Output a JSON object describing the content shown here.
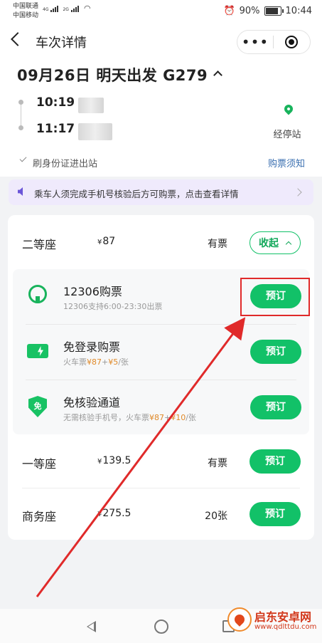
{
  "status_bar": {
    "carrier1": "中国联通",
    "carrier2": "中国移动",
    "net1": "4G",
    "net2": "2G",
    "battery": "90%",
    "time": "10:44"
  },
  "nav": {
    "title": "车次详情",
    "menu_glyph": "•••"
  },
  "trip": {
    "date_line": "09月26日 明天出发 G279",
    "depart_time": "10:19",
    "arrive_time": "11:17",
    "via_label": "经停站",
    "id_note": "刷身份证进出站",
    "notice_link": "购票须知"
  },
  "banner": {
    "text": "乘车人须完成手机号核验后方可购票，点击查看详情"
  },
  "seats": {
    "second": {
      "name": "二等座",
      "currency": "¥",
      "price": "87",
      "avail": "有票",
      "collapse_label": "收起"
    },
    "first": {
      "name": "一等座",
      "currency": "¥",
      "price": "139.5",
      "avail": "有票",
      "button": "预订"
    },
    "business": {
      "name": "商务座",
      "currency": "¥",
      "price": "275.5",
      "avail": "20张",
      "button": "预订"
    }
  },
  "options": [
    {
      "title": "12306购票",
      "sub": "12306支持6:00-23:30出票",
      "button": "预订"
    },
    {
      "title": "免登录购票",
      "sub_prefix": "火车票",
      "sub_price1": "¥87",
      "sub_plus": "+",
      "sub_price2": "¥5",
      "sub_suffix": "/张",
      "button": "预订"
    },
    {
      "title": "免核验通道",
      "sub_prefix": "无需核验手机号，火车票",
      "sub_price1": "¥87",
      "sub_plus": "+",
      "sub_price2": "¥10",
      "sub_suffix": "/张",
      "button": "预订",
      "icon_text": "免"
    }
  ],
  "watermark": {
    "name": "启东安卓网",
    "url": "www.qdlttdu.com"
  },
  "colors": {
    "accent_green": "#12c168",
    "highlight_red": "#e02a2a",
    "link_blue": "#3a6fb0",
    "banner_bg": "#efeafc",
    "price_orange": "#e08a2a"
  }
}
